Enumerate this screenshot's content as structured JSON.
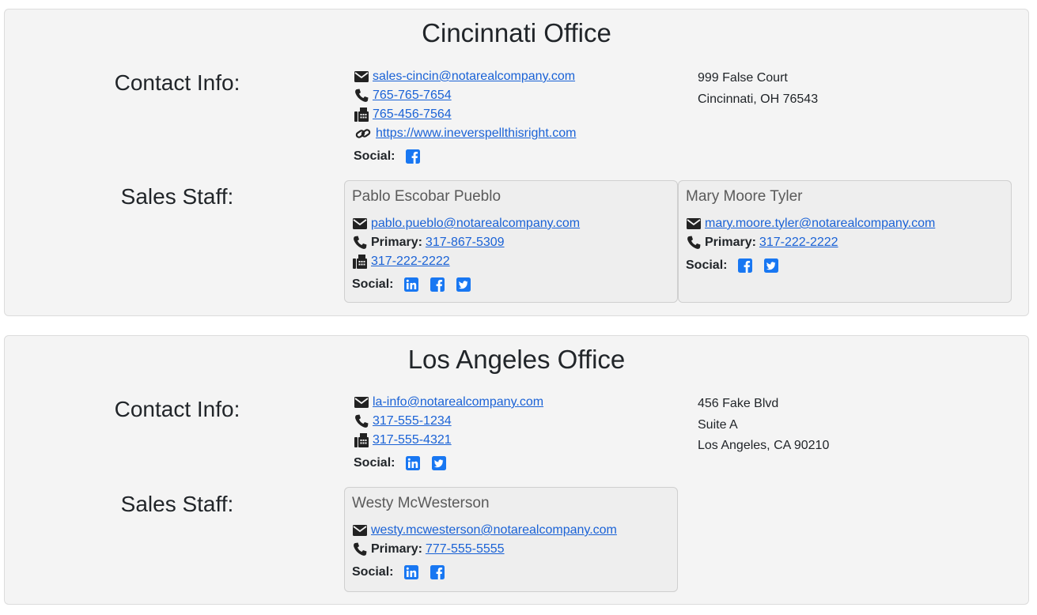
{
  "offices": [
    {
      "title": "Cincinnati Office",
      "contact_label": "Contact Info:",
      "staff_label": "Sales Staff:",
      "email": "sales-cincin@notarealcompany.com",
      "phone": "765-765-7654",
      "fax": "765-456-7564",
      "website": "https://www.ineverspellthisright.com",
      "social_label": "Social:",
      "social_icons": [
        "facebook-icon"
      ],
      "address": [
        "999 False Court",
        "Cincinnati, OH 76543"
      ],
      "staff": [
        {
          "name": "Pablo Escobar Pueblo",
          "email": "pablo.pueblo@notarealcompany.com",
          "primary_label": "Primary:",
          "phone": "317-867-5309",
          "fax": "317-222-2222",
          "social_label": "Social:",
          "social_icons": [
            "linkedin-icon",
            "facebook-icon",
            "twitter-icon"
          ]
        },
        {
          "name": "Mary Moore Tyler",
          "email": "mary.moore.tyler@notarealcompany.com",
          "primary_label": "Primary:",
          "phone": "317-222-2222",
          "social_label": "Social:",
          "social_icons": [
            "facebook-icon",
            "twitter-icon"
          ]
        }
      ]
    },
    {
      "title": "Los Angeles Office",
      "contact_label": "Contact Info:",
      "staff_label": "Sales Staff:",
      "email": "la-info@notarealcompany.com",
      "phone": "317-555-1234",
      "fax": "317-555-4321",
      "social_label": "Social:",
      "social_icons": [
        "linkedin-icon",
        "twitter-icon"
      ],
      "address": [
        "456 Fake Blvd",
        "Suite A",
        "Los Angeles, CA 90210"
      ],
      "staff": [
        {
          "name": "Westy McWesterson",
          "email": "westy.mcwesterson@notarealcompany.com",
          "primary_label": "Primary:",
          "phone": "777-555-5555",
          "social_label": "Social:",
          "social_icons": [
            "linkedin-icon",
            "facebook-icon"
          ]
        }
      ]
    }
  ],
  "colors": {
    "link": "#1a62d6",
    "social_brand": "#1877f2",
    "panel_bg": "#f4f4f4",
    "card_bg": "#eeeeee"
  }
}
